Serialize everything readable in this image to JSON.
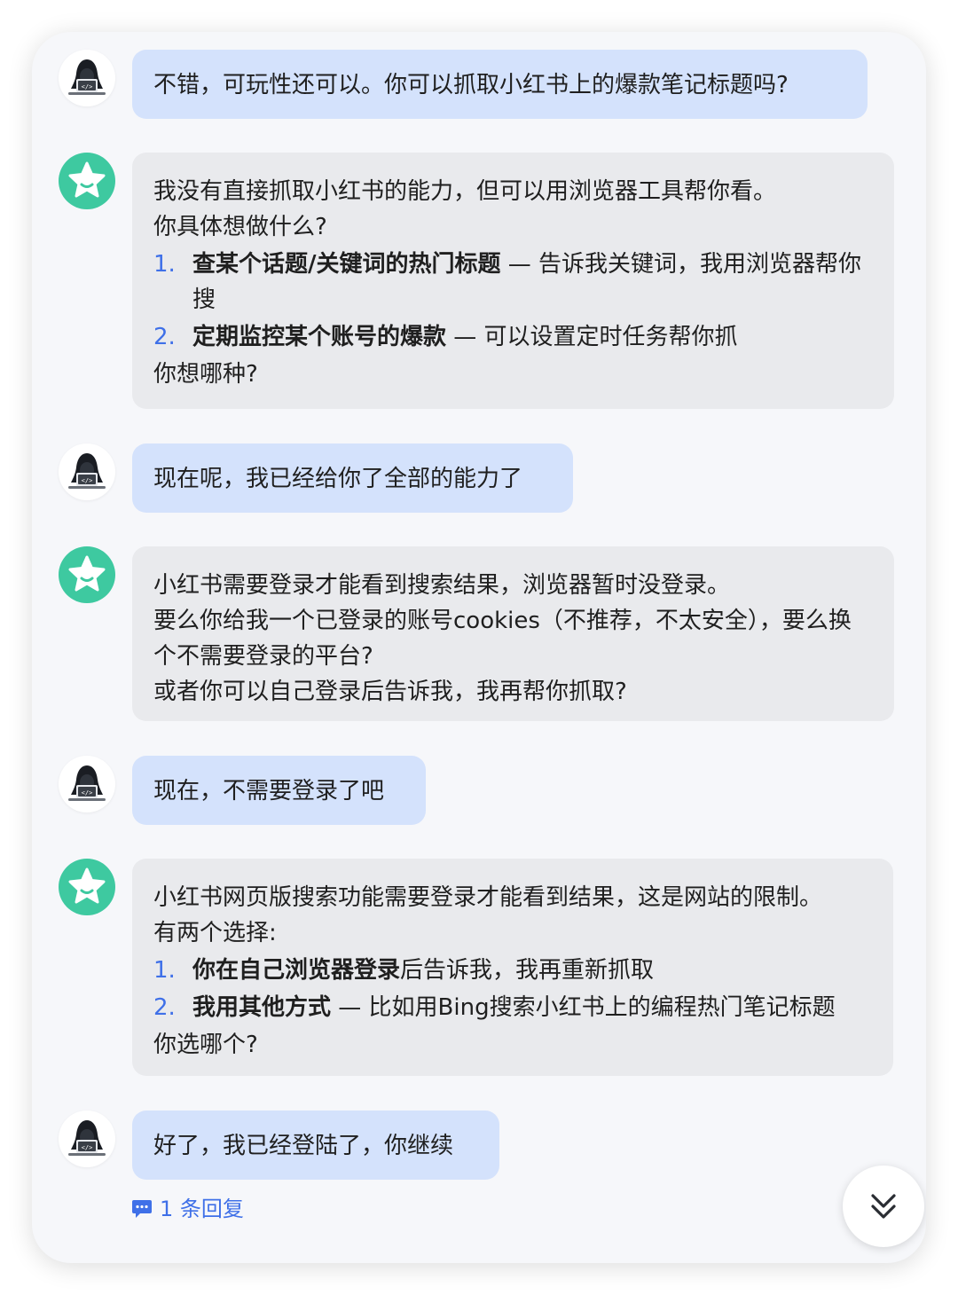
{
  "messages": [
    {
      "role": "user",
      "text": "不错，可玩性还可以。你可以抓取小红书上的爆款笔记标题吗?"
    },
    {
      "role": "assistant",
      "intro_1": "我没有直接抓取小红书的能力，但可以用浏览器工具帮你看。",
      "intro_2": "你具体想做什么?",
      "items": [
        {
          "num": "1.",
          "bold": "查某个话题/关键词的热门标题",
          "rest": " — 告诉我关键词，我用浏览器帮你搜"
        },
        {
          "num": "2.",
          "bold": "定期监控某个账号的爆款",
          "rest": " — 可以设置定时任务帮你抓"
        }
      ],
      "outro": "你想哪种?"
    },
    {
      "role": "user",
      "text": "现在呢，我已经给你了全部的能力了"
    },
    {
      "role": "assistant",
      "lines": [
        "小红书需要登录才能看到搜索结果，浏览器暂时没登录。",
        "要么你给我一个已登录的账号cookies（不推荐，不太安全），要么换个不需要登录的平台?",
        "或者你可以自己登录后告诉我，我再帮你抓取?"
      ]
    },
    {
      "role": "user",
      "text": "现在，不需要登录了吧"
    },
    {
      "role": "assistant",
      "intro_1": "小红书网页版搜索功能需要登录才能看到结果，这是网站的限制。",
      "intro_2": "有两个选择:",
      "items": [
        {
          "num": "1.",
          "bold": "你在自己浏览器登录",
          "rest": "后告诉我，我再重新抓取"
        },
        {
          "num": "2.",
          "bold": "我用其他方式",
          "rest": " — 比如用Bing搜索小红书上的编程热门笔记标题"
        }
      ],
      "outro": "你选哪个?"
    },
    {
      "role": "user",
      "text": "好了，我已经登陆了，你继续"
    }
  ],
  "reply_thread": {
    "label": "1 条回复",
    "icon": "comment-bubble-icon"
  },
  "scroll_button": {
    "icon": "double-chevron-down-icon"
  },
  "colors": {
    "user_bubble": "#d4e2fc",
    "assistant_bubble": "#e9eaed",
    "accent": "#3f70e8",
    "bot_avatar": "#3ec9a0"
  }
}
